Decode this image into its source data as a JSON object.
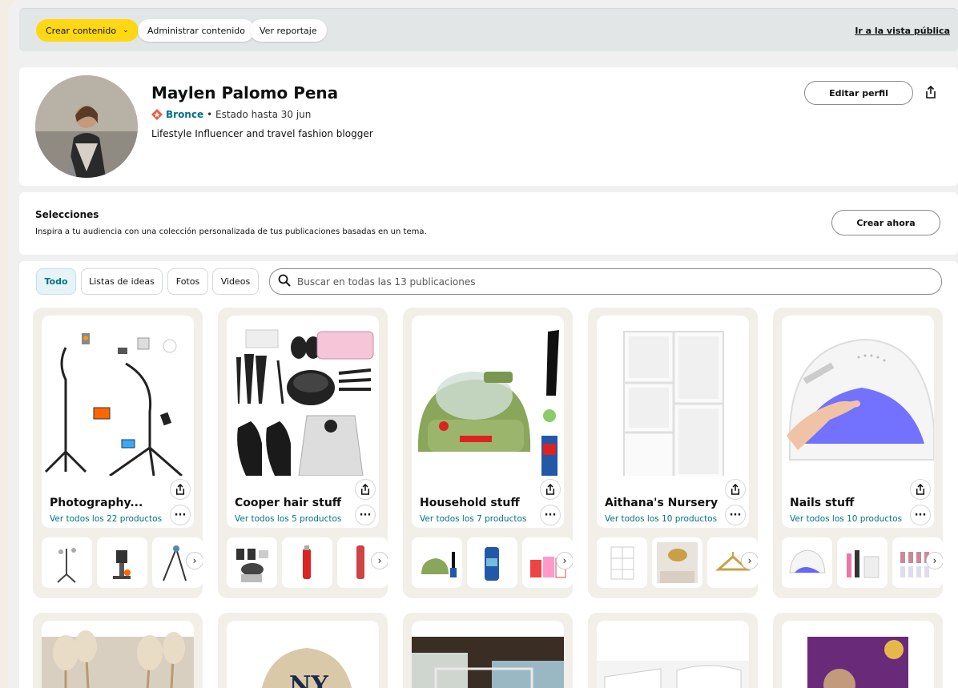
{
  "toolbar": {
    "create_label": "Crear contenido",
    "manage_label": "Administrar contenido",
    "report_label": "Ver reportaje",
    "public_link": "Ir a la vista pública"
  },
  "profile": {
    "name": "Maylen Palomo Pena",
    "tier": "Bronce",
    "tier_status": "• Estado hasta 30 jun",
    "bio": "Lifestyle Influencer and travel fashion blogger",
    "edit_label": "Editar perfil"
  },
  "selections": {
    "title": "Selecciones",
    "description": "Inspira a tu audiencia con una colección personalizada de tus publicaciones basadas en un tema.",
    "create_label": "Crear ahora"
  },
  "filters": {
    "tabs": [
      "Todo",
      "Listas de ideas",
      "Fotos",
      "Videos"
    ],
    "search_placeholder": "Buscar en todas las 13 publicaciones"
  },
  "cards": [
    {
      "title": "Photography...",
      "link": "Ver todos los 22 productos"
    },
    {
      "title": "Cooper hair stuff",
      "link": "Ver todos los 5 productos"
    },
    {
      "title": "Household stuff",
      "link": "Ver todos los 7 productos"
    },
    {
      "title": "Aithana's Nursery",
      "link": "Ver todos los 10 productos"
    },
    {
      "title": "Nails stuff",
      "link": "Ver todos los 10 productos"
    }
  ],
  "colors": {
    "accent": "#ffd814",
    "link": "#007185",
    "bronze": "#e8603c"
  }
}
